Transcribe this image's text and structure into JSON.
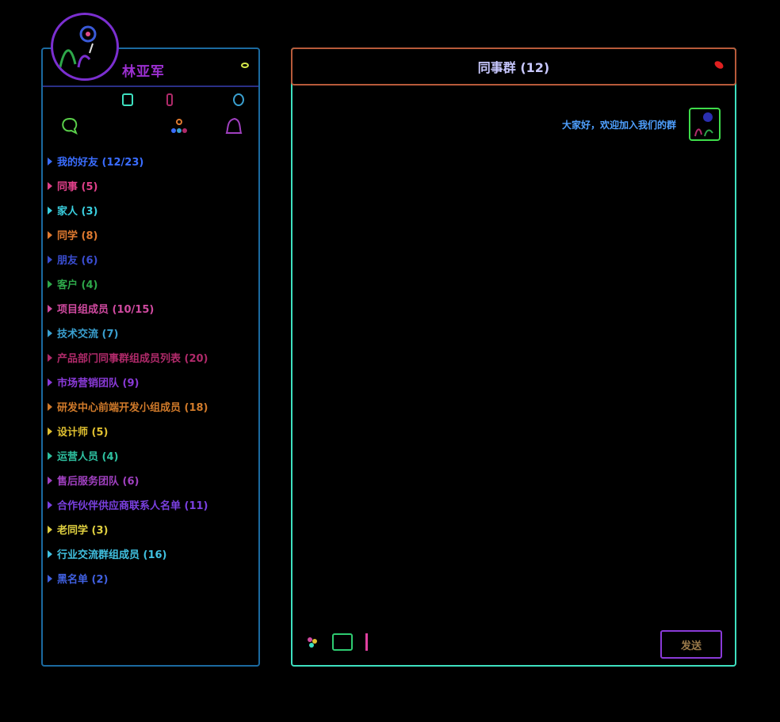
{
  "user": {
    "name": "林亚军"
  },
  "chat": {
    "title": "同事群 (12)",
    "message": "大家好，欢迎加入我们的群"
  },
  "composer": {
    "send_label": "发送"
  },
  "groups": [
    {
      "label": "我的好友 (12/23)",
      "color": "#3a6dff"
    },
    {
      "label": "同事 (5)",
      "color": "#e0408a"
    },
    {
      "label": "家人 (3)",
      "color": "#3ad0e0"
    },
    {
      "label": "同学 (8)",
      "color": "#e07a30"
    },
    {
      "label": "朋友 (6)",
      "color": "#3a4dd0"
    },
    {
      "label": "客户 (4)",
      "color": "#2ea84a"
    },
    {
      "label": "项目组成员 (10/15)",
      "color": "#d04aa0"
    },
    {
      "label": "技术交流 (7)",
      "color": "#3aa0d0"
    },
    {
      "label": "产品部门同事群组成员列表 (20)",
      "color": "#b02a6a"
    },
    {
      "label": "市场营销团队 (9)",
      "color": "#8a3ad8"
    },
    {
      "label": "研发中心前端开发小组成员 (18)",
      "color": "#d07a2a"
    },
    {
      "label": "设计师 (5)",
      "color": "#e0c030"
    },
    {
      "label": "运营人员 (4)",
      "color": "#2ec0a0"
    },
    {
      "label": "售后服务团队 (6)",
      "color": "#a040c0"
    },
    {
      "label": "合作伙伴供应商联系人名单 (11)",
      "color": "#7a40e0"
    },
    {
      "label": "老同学 (3)",
      "color": "#e0d040"
    },
    {
      "label": "行业交流群组成员 (16)",
      "color": "#40c0e0"
    },
    {
      "label": "黑名单 (2)",
      "color": "#4060e0"
    }
  ]
}
